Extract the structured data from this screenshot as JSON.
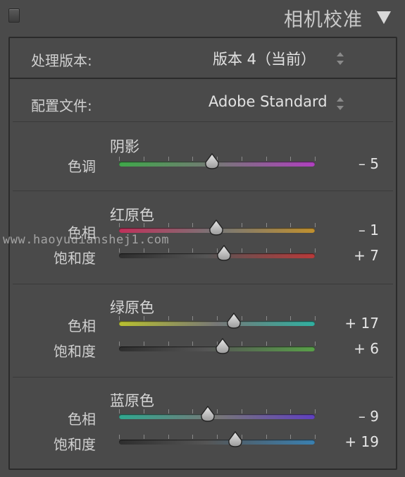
{
  "panel": {
    "title": "相机校准",
    "collapse_icon": "triangle-down-icon"
  },
  "process": {
    "label": "处理版本:",
    "value": "版本 4（当前）"
  },
  "profile": {
    "label": "配置文件:",
    "value": "Adobe Standard"
  },
  "groups": [
    {
      "title": "阴影",
      "sliders": [
        {
          "label": "色调",
          "value": "– 5",
          "level": -5,
          "range": [
            -100,
            100
          ],
          "colors": [
            "#3fa84a",
            "#b040c0"
          ]
        }
      ]
    },
    {
      "title": "红原色",
      "sliders": [
        {
          "label": "色相",
          "value": "– 1",
          "level": -1,
          "range": [
            -100,
            100
          ],
          "colors": [
            "#c0305a",
            "#c0902e"
          ]
        },
        {
          "label": "饱和度",
          "value": "+ 7",
          "level": 7,
          "range": [
            -100,
            100
          ],
          "colors": [
            "#3a3a3a",
            "#b83a3a"
          ]
        }
      ]
    },
    {
      "title": "绿原色",
      "sliders": [
        {
          "label": "色相",
          "value": "+ 17",
          "level": 17,
          "range": [
            -100,
            100
          ],
          "colors": [
            "#b8c030",
            "#30b0a0"
          ]
        },
        {
          "label": "饱和度",
          "value": "+ 6",
          "level": 6,
          "range": [
            -100,
            100
          ],
          "colors": [
            "#3a3a3a",
            "#58a048"
          ]
        }
      ]
    },
    {
      "title": "蓝原色",
      "sliders": [
        {
          "label": "色相",
          "value": "– 9",
          "level": -9,
          "range": [
            -100,
            100
          ],
          "colors": [
            "#30a890",
            "#6040c0"
          ]
        },
        {
          "label": "饱和度",
          "value": "+ 19",
          "level": 19,
          "range": [
            -100,
            100
          ],
          "colors": [
            "#3a3a3a",
            "#3a80b0"
          ]
        }
      ]
    }
  ],
  "watermark": "www.haoyudianshej1.com"
}
